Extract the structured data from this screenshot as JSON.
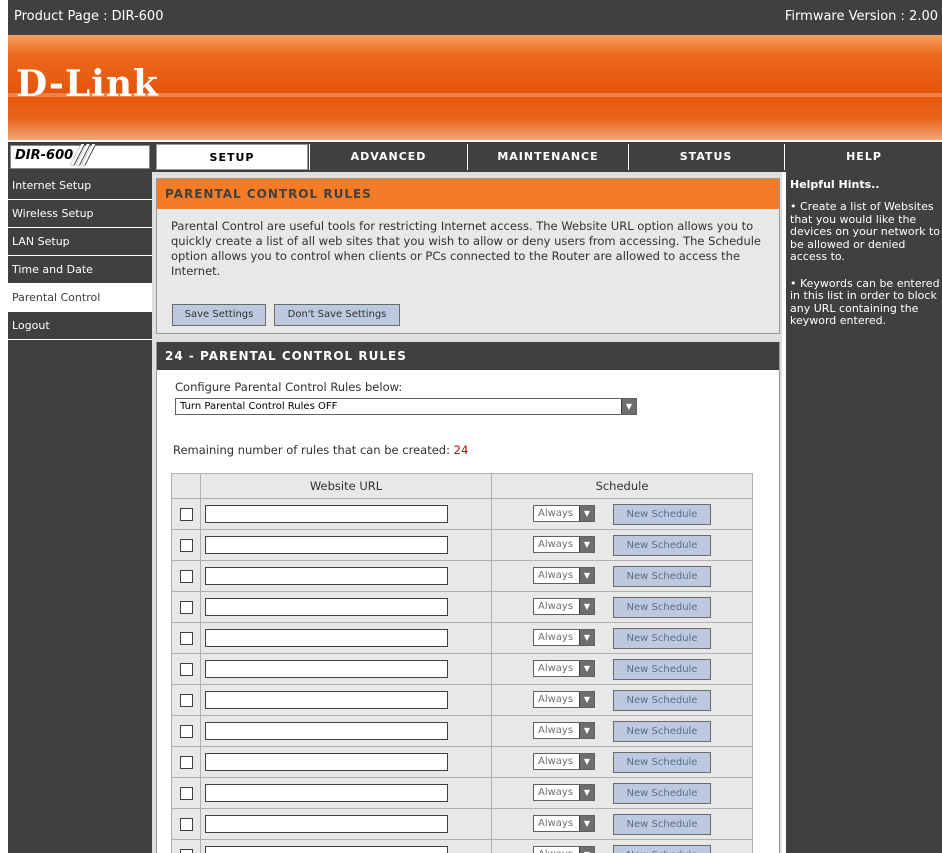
{
  "topbar": {
    "product": "Product Page :  DIR-600",
    "firmware": "Firmware Version : 2.00"
  },
  "brand": {
    "logo": "D-Link",
    "model": "DIR-600",
    "slashes": "///"
  },
  "tabs": [
    {
      "label": "SETUP",
      "active": true
    },
    {
      "label": "ADVANCED",
      "active": false
    },
    {
      "label": "MAINTENANCE",
      "active": false
    },
    {
      "label": "STATUS",
      "active": false
    },
    {
      "label": "HELP",
      "active": false
    }
  ],
  "sidebar": {
    "items": [
      {
        "label": "Internet Setup"
      },
      {
        "label": "Wireless Setup"
      },
      {
        "label": "LAN Setup"
      },
      {
        "label": "Time and Date"
      },
      {
        "label": "Parental Control"
      },
      {
        "label": "Logout"
      }
    ]
  },
  "parental": {
    "header": "PARENTAL CONTROL RULES",
    "description": "Parental Control are useful tools for restricting Internet access. The Website URL option allows you to quickly create a list of all web sites that you wish to allow or deny users from accessing. The Schedule option allows you to control when clients or PCs connected to the Router are allowed to access the Internet.",
    "save_label": "Save Settings",
    "dont_save_label": "Don't Save Settings"
  },
  "rules": {
    "header": "24 - PARENTAL CONTROL RULES",
    "configure_label": "Configure Parental Control Rules below:",
    "mode_value": "Turn Parental Control Rules OFF",
    "remaining_label": "Remaining number of rules that can be created:",
    "remaining_count": "24",
    "col_url": "Website URL",
    "col_schedule": "Schedule",
    "schedule_value": "Always",
    "new_schedule_label": "New Schedule",
    "row_count": 12
  },
  "help": {
    "title": "Helpful Hints..",
    "hint1": "• Create a list of Websites that you would like the devices on your network to be allowed or denied access to.",
    "hint2": "• Keywords can be entered in this list in order to block any URL containing the keyword entered."
  },
  "colors": {
    "orange": "#f47c26",
    "dark": "#404040",
    "button": "#bcc9df",
    "accent_red": "#c00000"
  }
}
